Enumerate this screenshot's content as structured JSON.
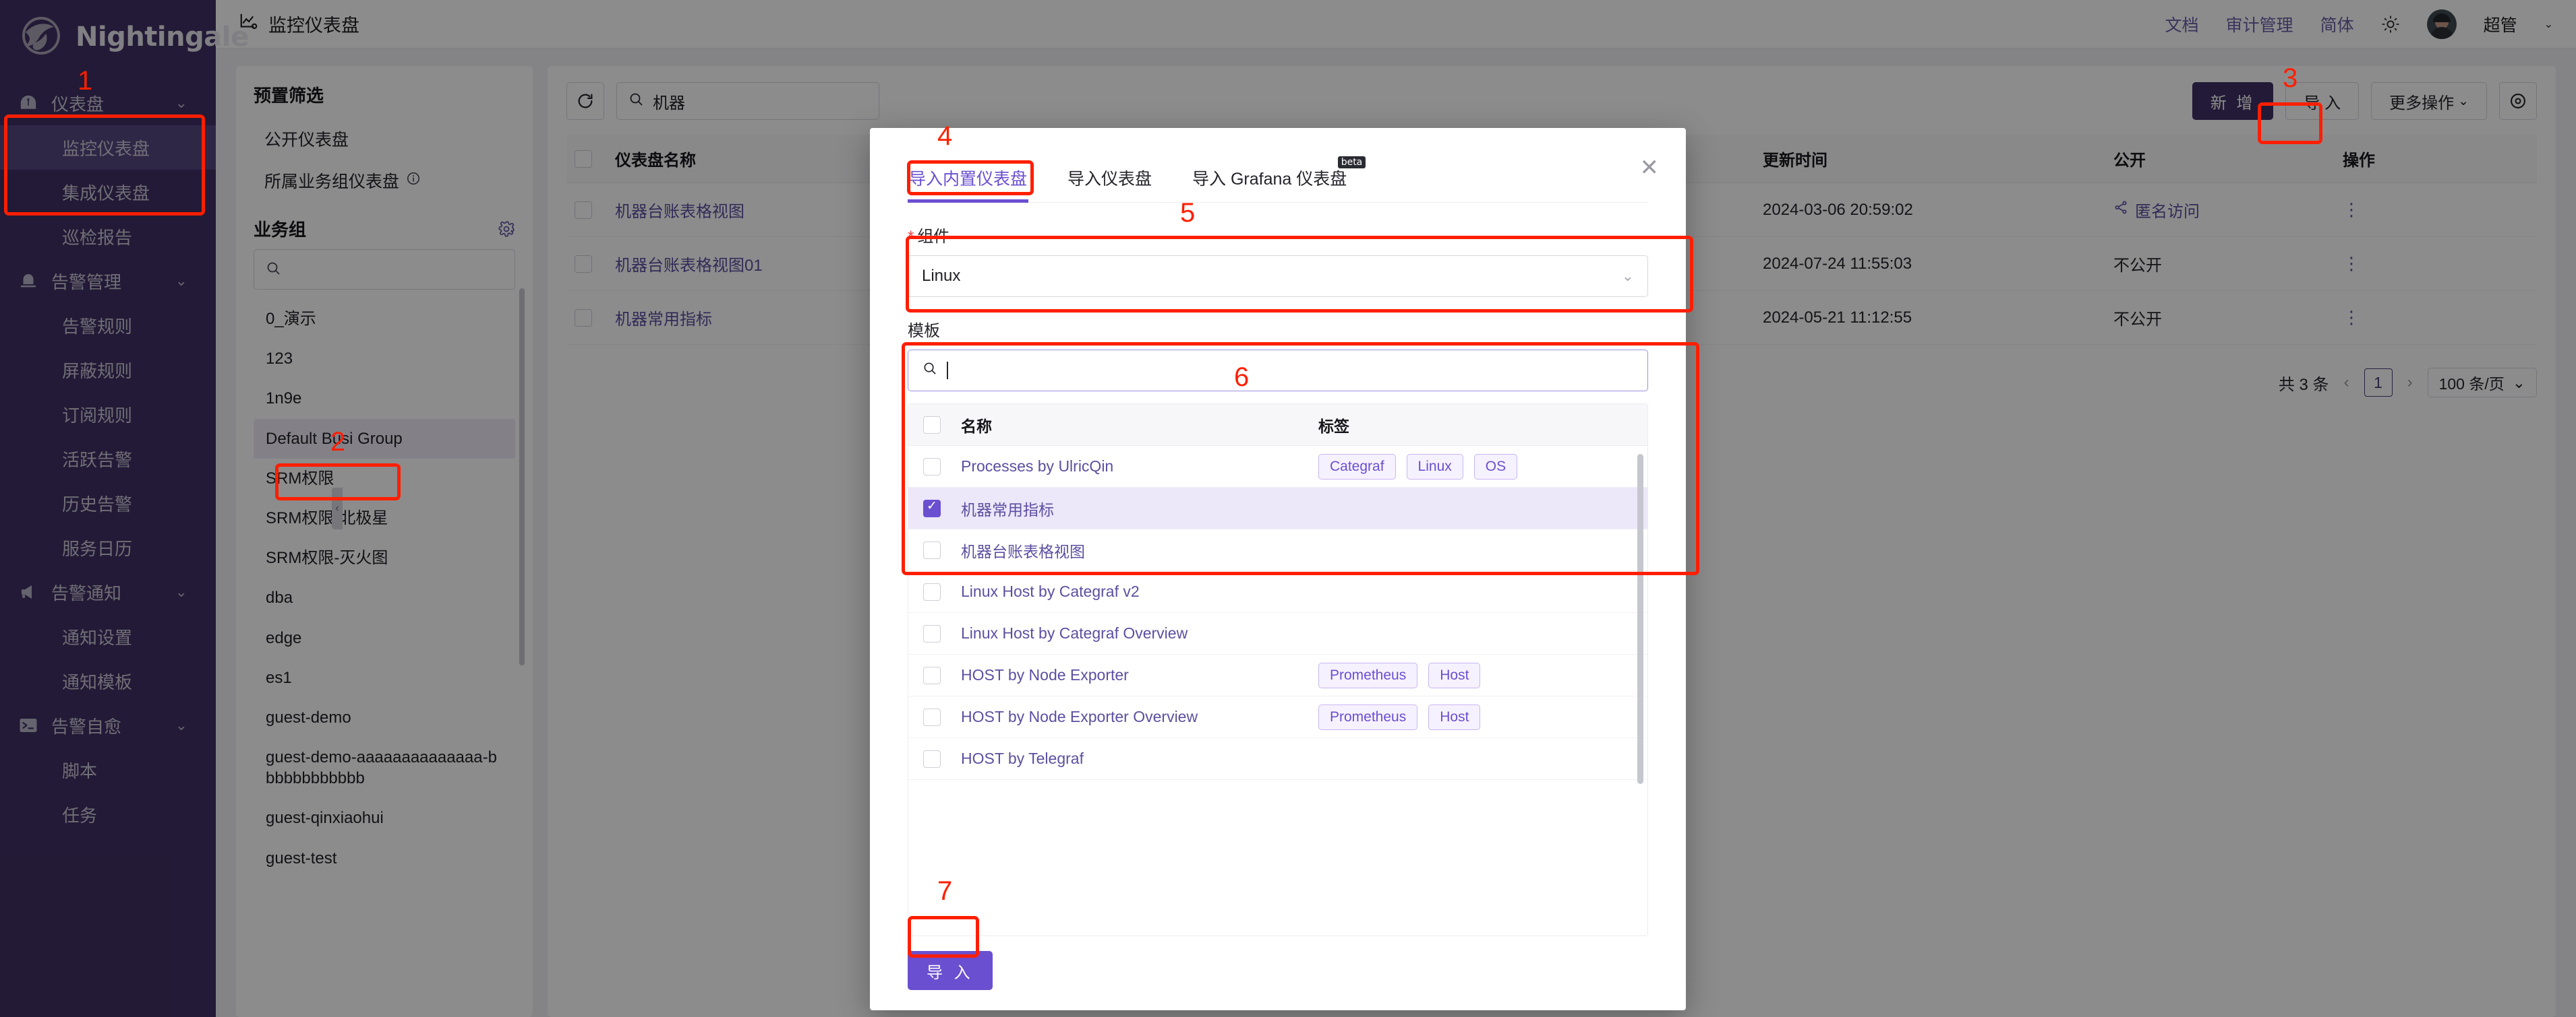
{
  "brand": {
    "name": "Nightingale"
  },
  "sidebar": {
    "groups": [
      {
        "icon": "gauge-icon",
        "label": "仪表盘",
        "expandable": true,
        "active": true,
        "children": [
          {
            "label": "监控仪表盘",
            "active": true
          },
          {
            "label": "集成仪表盘",
            "active": false
          },
          {
            "label": "巡检报告",
            "active": false
          }
        ]
      },
      {
        "icon": "bell-icon",
        "label": "告警管理",
        "expandable": true,
        "active": false,
        "children": [
          {
            "label": "告警规则",
            "active": false
          },
          {
            "label": "屏蔽规则",
            "active": false
          },
          {
            "label": "订阅规则",
            "active": false
          },
          {
            "label": "活跃告警",
            "active": false
          },
          {
            "label": "历史告警",
            "active": false
          },
          {
            "label": "服务日历",
            "active": false
          }
        ]
      },
      {
        "icon": "megaphone-icon",
        "label": "告警通知",
        "expandable": true,
        "active": false,
        "children": [
          {
            "label": "通知设置",
            "active": false
          },
          {
            "label": "通知模板",
            "active": false
          }
        ]
      },
      {
        "icon": "terminal-icon",
        "label": "告警自愈",
        "expandable": true,
        "active": false,
        "children": [
          {
            "label": "脚本",
            "active": false
          },
          {
            "label": "任务",
            "active": false
          }
        ]
      }
    ]
  },
  "topbar": {
    "title": "监控仪表盘",
    "title_icon": "chart-line-icon",
    "links": [
      "文档",
      "审计管理",
      "简体"
    ],
    "theme_icon": "sun-icon",
    "avatar_icon": "user-avatar",
    "user_name": "超管",
    "user_chevron": "⌄"
  },
  "filter_panel": {
    "preset_title": "预置筛选",
    "presets": [
      {
        "label": "公开仪表盘",
        "info": false
      },
      {
        "label": "所属业务组仪表盘",
        "info": true,
        "info_icon": "info-circle-icon"
      }
    ],
    "busi_group_title": "业务组",
    "gear_icon": "gear-icon",
    "search_placeholder": "",
    "search_icon": "search-icon",
    "groups": [
      {
        "label": "0_演示",
        "active": false
      },
      {
        "label": "123",
        "active": false
      },
      {
        "label": "1n9e",
        "active": false
      },
      {
        "label": "Default Busi Group",
        "active": true
      },
      {
        "label": "SRM权限",
        "active": false
      },
      {
        "label": "SRM权限-北极星",
        "active": false
      },
      {
        "label": "SRM权限-灭火图",
        "active": false
      },
      {
        "label": "dba",
        "active": false
      },
      {
        "label": "edge",
        "active": false
      },
      {
        "label": "es1",
        "active": false
      },
      {
        "label": "guest-demo",
        "active": false
      },
      {
        "label": "guest-demo-aaaaaaaaaaaaaa-bbbbbbbbbbbb",
        "active": false
      },
      {
        "label": "guest-qinxiaohui",
        "active": false
      },
      {
        "label": "guest-test",
        "active": false
      }
    ]
  },
  "toolbar": {
    "refresh_icon": "refresh-icon",
    "search_icon": "search-icon",
    "search_value": "机器",
    "search_placeholder": "",
    "add_label": "新 增",
    "import_label": "导 入",
    "more_label": "更多操作",
    "more_chevron": "⌄",
    "eye_icon": "eye-icon"
  },
  "table": {
    "columns": [
      "仪表盘名称",
      "更新时间",
      "公开",
      "操作"
    ],
    "rows": [
      {
        "checked": false,
        "name": "机器台账表格视图",
        "updated": "2024-03-06 20:59:02",
        "public": "匿名访问",
        "public_icon": "share-icon",
        "public_is_link": true,
        "action_icon": "kebab-icon"
      },
      {
        "checked": false,
        "name": "机器台账表格视图01",
        "updated": "2024-07-24 11:55:03",
        "public": "不公开",
        "public_icon": "",
        "public_is_link": false,
        "action_icon": "kebab-icon"
      },
      {
        "checked": false,
        "name": "机器常用指标",
        "updated": "2024-05-21 11:12:55",
        "public": "不公开",
        "public_icon": "",
        "public_is_link": false,
        "action_icon": "kebab-icon"
      }
    ],
    "pagination": {
      "total_label": "共 3 条",
      "prev_icon": "chevron-left-icon",
      "page": "1",
      "next_icon": "chevron-right-icon",
      "page_size": "100 条/页",
      "page_size_chevron": "⌄"
    }
  },
  "modal": {
    "close_icon": "close-icon",
    "tabs": [
      {
        "label": "导入内置仪表盘",
        "active": true,
        "badge": ""
      },
      {
        "label": "导入仪表盘",
        "active": false,
        "badge": ""
      },
      {
        "label": "导入 Grafana 仪表盘",
        "active": false,
        "badge": "beta"
      }
    ],
    "component_label": "组件",
    "component_required": "*",
    "component_value": "Linux",
    "component_chevron": "⌄",
    "template_label": "模板",
    "template_search_icon": "search-icon",
    "template_search_value": "",
    "template_columns": [
      "名称",
      "标签"
    ],
    "header_checkbox": false,
    "templates": [
      {
        "checked": false,
        "name": "Processes by UlricQin",
        "tags": [
          "Categraf",
          "Linux",
          "OS"
        ]
      },
      {
        "checked": true,
        "name": "机器常用指标",
        "tags": []
      },
      {
        "checked": false,
        "name": "机器台账表格视图",
        "tags": []
      },
      {
        "checked": false,
        "name": "Linux Host by Categraf v2",
        "tags": []
      },
      {
        "checked": false,
        "name": "Linux Host by Categraf Overview",
        "tags": []
      },
      {
        "checked": false,
        "name": "HOST by Node Exporter",
        "tags": [
          "Prometheus",
          "Host"
        ]
      },
      {
        "checked": false,
        "name": "HOST by Node Exporter Overview",
        "tags": [
          "Prometheus",
          "Host"
        ]
      },
      {
        "checked": false,
        "name": "HOST by Telegraf",
        "tags": []
      }
    ],
    "import_button": "导 入"
  },
  "annotations": [
    {
      "number": "1"
    },
    {
      "number": "2"
    },
    {
      "number": "3"
    },
    {
      "number": "4"
    },
    {
      "number": "5"
    },
    {
      "number": "6"
    },
    {
      "number": "7"
    }
  ],
  "colors": {
    "sidebar_bg": "#3f3163",
    "accent": "#6a4fd0",
    "annotation": "#ff1f00",
    "link": "#5c4fa1"
  }
}
